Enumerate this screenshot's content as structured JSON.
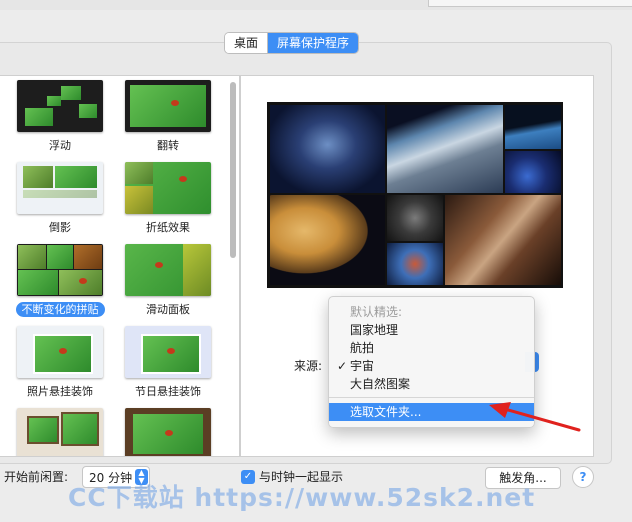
{
  "tabs": {
    "desktop": "桌面",
    "screensaver": "屏幕保护程序"
  },
  "screensavers": [
    {
      "label": "浮动"
    },
    {
      "label": "翻转"
    },
    {
      "label": "倒影"
    },
    {
      "label": "折纸效果"
    },
    {
      "label": "不断变化的拼贴"
    },
    {
      "label": "滑动面板"
    },
    {
      "label": "照片悬挂装饰"
    },
    {
      "label": "节日悬挂装饰"
    }
  ],
  "source": {
    "label": "来源:",
    "menu": {
      "header": "默认精选:",
      "items": [
        "国家地理",
        "航拍",
        "宇宙",
        "大自然图案"
      ],
      "checked_item": "宇宙",
      "choose_folder": "选取文件夹..."
    }
  },
  "bottom": {
    "idle_label": "开始前闲置:",
    "idle_value": "20 分钟",
    "show_clock_label": "与时钟一起显示",
    "show_clock_checked": true,
    "hot_corners": "触发角...",
    "help": "?"
  },
  "watermark": "CC下载站 https://www.52sk2.net",
  "colors": {
    "accent": "#3d8ef5",
    "arrow": "#e0221e"
  },
  "icons": {
    "check": "✓",
    "stepper": "updown",
    "help": "question-mark"
  }
}
